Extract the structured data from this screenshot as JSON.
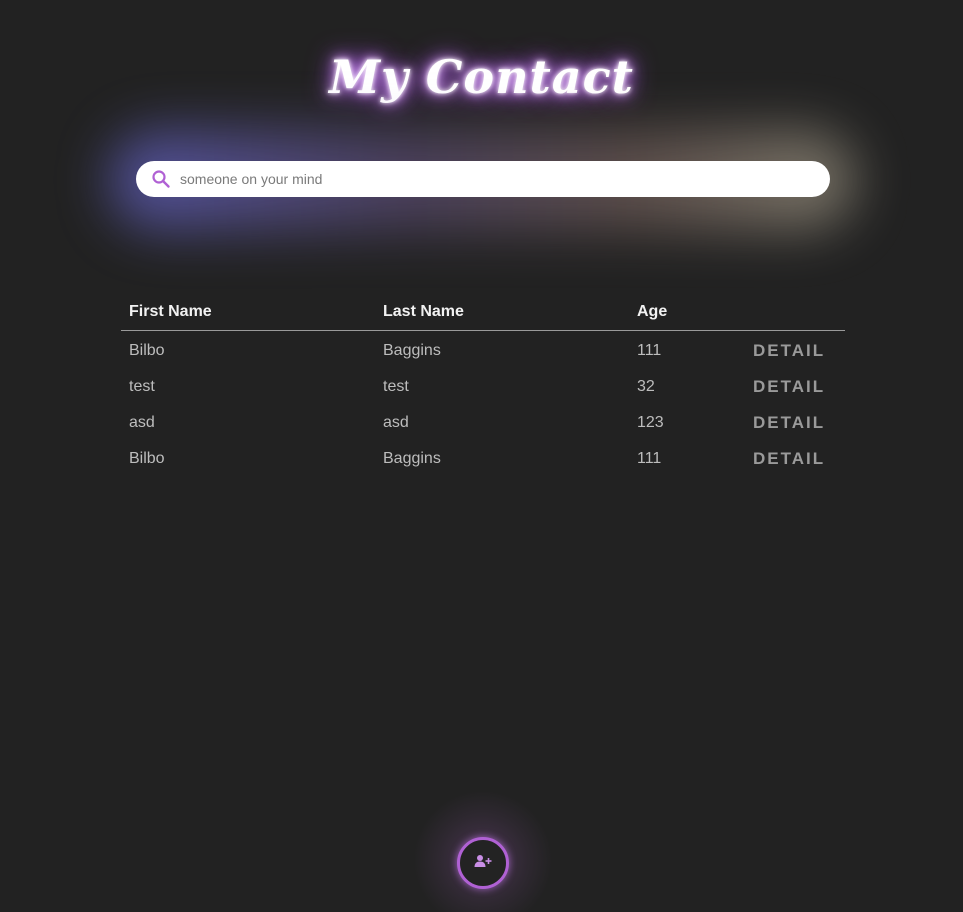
{
  "header": {
    "title": "My Contact"
  },
  "search": {
    "placeholder": "someone on your mind",
    "value": "",
    "icon": "search-icon"
  },
  "table": {
    "columns": [
      "First Name",
      "Last Name",
      "Age"
    ],
    "rows": [
      {
        "first_name": "Bilbo",
        "last_name": "Baggins",
        "age": "111",
        "action": "DETAIL"
      },
      {
        "first_name": "test",
        "last_name": "test",
        "age": "32",
        "action": "DETAIL"
      },
      {
        "first_name": "asd",
        "last_name": "asd",
        "age": "123",
        "action": "DETAIL"
      },
      {
        "first_name": "Bilbo",
        "last_name": "Baggins",
        "age": "111",
        "action": "DETAIL"
      }
    ]
  },
  "fab": {
    "icon": "add-user-icon"
  },
  "colors": {
    "background": "#222222",
    "accent": "#b061d4",
    "glow": "#c77dff"
  }
}
